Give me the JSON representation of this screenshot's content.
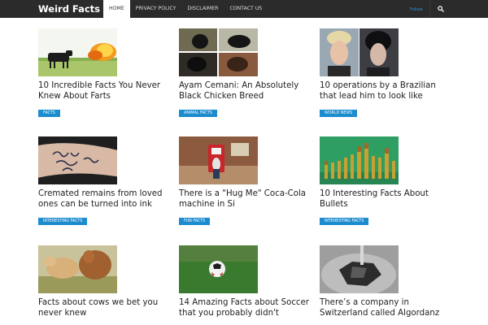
{
  "header": {
    "brand": "Weird Facts",
    "nav": [
      "HOME",
      "PRIVACY POLICY",
      "DISCLAIMER",
      "CONTACT US"
    ],
    "follow_label": "Follow",
    "search_icon": "search-icon"
  },
  "colors": {
    "nav_bg": "#2b2b2b",
    "accent": "#1c8ccf"
  },
  "posts": [
    {
      "title": "10 Incredible Facts You Never Knew About Farts",
      "category": "FACTS",
      "image": "cow-and-fire"
    },
    {
      "title": "Ayam Cemani: An Absolutely Black Chicken Breed",
      "category": "ANIMAL FACTS",
      "image": "black-chicken-collage"
    },
    {
      "title": "10 operations by a Brazilian that lead him to look like",
      "category": "WORLD NEWS",
      "image": "before-after-faces"
    },
    {
      "title": "Cremated remains from loved ones can be turned into ink",
      "category": "INTERESTING FACTS",
      "image": "arm-tattoo"
    },
    {
      "title": "There is a \"Hug Me\" Coca-Cola machine in Si",
      "category": "FUN FACTS",
      "image": "red-vending-machine"
    },
    {
      "title": "10 Interesting Facts About Bullets",
      "category": "INTERESTING FACTS",
      "image": "row-of-bullets"
    },
    {
      "title": "Facts about cows we bet you never knew",
      "category": "",
      "image": "two-cows"
    },
    {
      "title": "14 Amazing Facts about Soccer that you probably didn't",
      "category": "",
      "image": "soccer-ball-on-grass"
    },
    {
      "title": "There’s a company in Switzerland called Algordanz",
      "category": "",
      "image": "diamond-in-hand"
    }
  ]
}
